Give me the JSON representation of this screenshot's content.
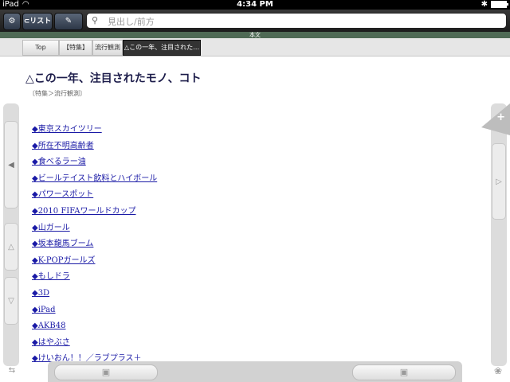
{
  "status": {
    "device": "iPad",
    "time": "4:34 PM",
    "bluetooth_icon": "bluetooth-icon",
    "battery_icon": "battery-icon"
  },
  "toolbar": {
    "list_button": "⊂リスト",
    "search_placeholder": "見出し/前方",
    "icons": [
      "gear-icon",
      "pen-icon",
      "search-icon"
    ]
  },
  "section_band": "本文",
  "breadcrumb": {
    "items": [
      "Top",
      "【特集】",
      "流行観測"
    ],
    "current": "△この一年、注目された…"
  },
  "article": {
    "title": "△この一年、注目されたモノ、コト",
    "category": "〔特集＞流行観測〕",
    "items": [
      "◆東京スカイツリー",
      "◆所在不明高齢者",
      "◆食べるラー油",
      "◆ビールテイスト飲料とハイボール",
      "◆パワースポット",
      "◆2010 FIFAワールドカップ",
      "◆山ガール",
      "◆坂本龍馬ブーム",
      "◆K-POPガールズ",
      "◆もしドラ",
      "◆3D",
      "◆iPad",
      "◆AKB48",
      "◆はやぶさ",
      "◆けいおん！！／ラブプラス＋"
    ]
  },
  "colors": {
    "link": "#1a1aa6",
    "title": "#1c1c4a",
    "section_band": "#4f6a55",
    "toolbar": "#2a2a2a"
  }
}
